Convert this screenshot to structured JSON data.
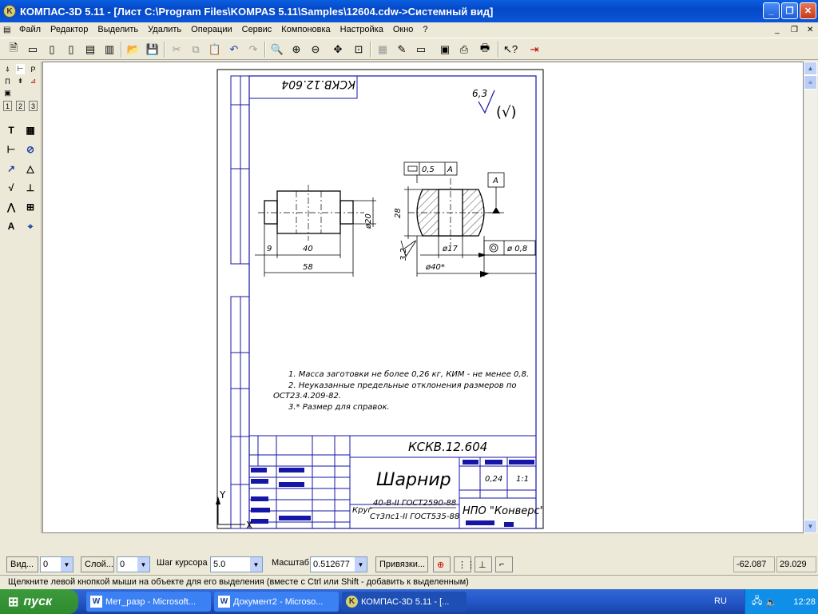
{
  "window": {
    "title": "КОМПАС-3D 5.11 - [Лист C:\\Program Files\\KOMPAS 5.11\\Samples\\12604.cdw->Системный вид]"
  },
  "menu": [
    "Файл",
    "Редактор",
    "Выделить",
    "Удалить",
    "Операции",
    "Сервис",
    "Компоновка",
    "Настройка",
    "Окно",
    "?"
  ],
  "left_tabs": [
    "1",
    "2",
    "3"
  ],
  "drawing": {
    "stamp_rot": "КСКВ.12.604",
    "roughness": "6,3",
    "roughness_sym": "(√)",
    "tol_flat": "0,5",
    "tol_datum": "А",
    "datum_a": "А",
    "dim_20": "ø20",
    "dim_9": "9",
    "dim_40": "40",
    "dim_58": "58",
    "dim_28": "28",
    "dim_17": "ø17",
    "dim_40s": "ø40*",
    "dim_32": "3,2",
    "tol_coax": "ø 0,8",
    "notes": [
      "1. Масса заготовки не более 0,26 кг, КИМ - не менее 0,8.",
      "2. Неуказанные предельные отклонения размеров по",
      "ОСТ23.4.209-82.",
      "3.* Размер для справок."
    ],
    "tb_code": "КСКВ.12.604",
    "tb_name": "Шарнир",
    "tb_mass": "0,24",
    "tb_scale": "1:1",
    "tb_mat1_a": "Круг",
    "tb_mat1_b": "40-В-II ГОСТ2590-88",
    "tb_mat2": "Ст3пс1-II ГОСТ535-88",
    "tb_org": "НПО \"Конверс\"",
    "axis_y": "Y",
    "axis_x": "X"
  },
  "status": {
    "vid_label": "Вид...",
    "vid_value": "0",
    "layer_label": "Слой...",
    "layer_value": "0",
    "step_label": "Шаг курсора",
    "step_value": "5.0",
    "scale_label": "Масштаб",
    "scale_value": "0.512677",
    "snap_label": "Привязки...",
    "coord_x": "-62.087",
    "coord_y": "29.029"
  },
  "hint": "Щелкните левой кнопкой мыши на объекте для его выделения (вместе с Ctrl или Shift - добавить к выделенным)",
  "taskbar": {
    "start": "пуск",
    "tasks": [
      "Мет_разр - Microsoft...",
      "Документ2 - Microso...",
      "КОМПАС-3D 5.11 - [..."
    ],
    "lang": "RU",
    "clock": "12:28"
  }
}
